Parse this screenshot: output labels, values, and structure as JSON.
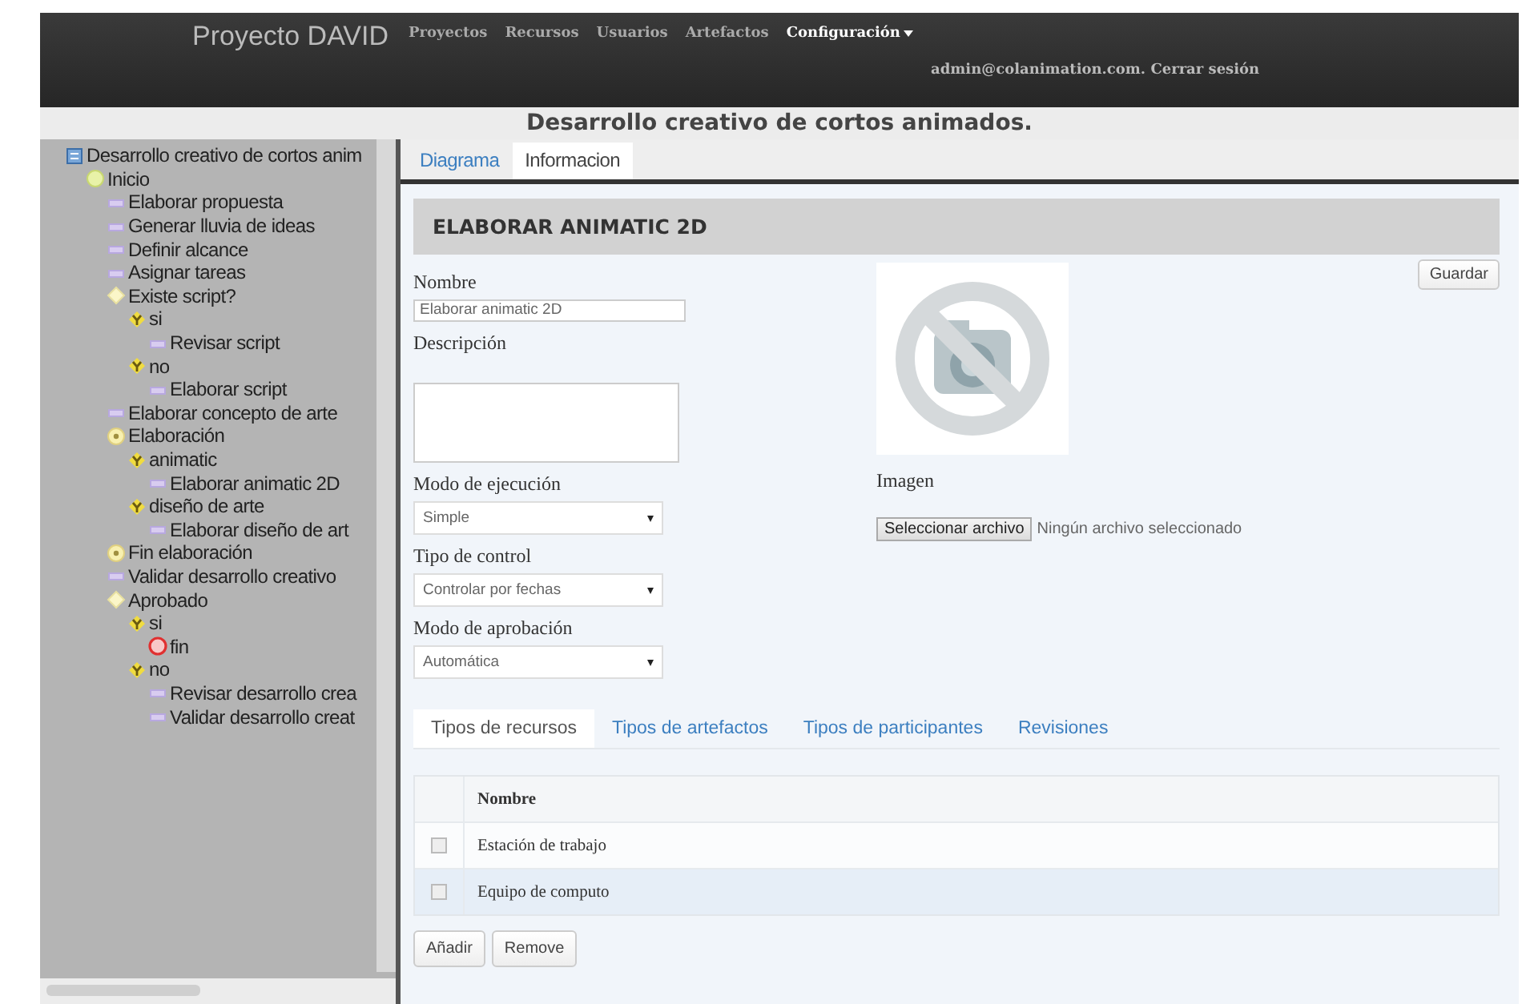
{
  "header": {
    "brand": "Proyecto DAVID",
    "nav": [
      {
        "label": "Proyectos",
        "selected": false,
        "dropdown": false
      },
      {
        "label": "Recursos",
        "selected": false,
        "dropdown": false
      },
      {
        "label": "Usuarios",
        "selected": false,
        "dropdown": false
      },
      {
        "label": "Artefactos",
        "selected": false,
        "dropdown": false
      },
      {
        "label": "Configuración",
        "selected": true,
        "dropdown": true
      }
    ],
    "user_line": "admin@colanimation.com. Cerrar sesión"
  },
  "page_title": "Desarrollo creativo de cortos animados.",
  "tree": [
    {
      "label": "Desarrollo creativo de cortos anim",
      "kind": "process",
      "children": [
        {
          "label": "Inicio",
          "kind": "start",
          "children": [
            {
              "label": "Elaborar propuesta",
              "kind": "task"
            },
            {
              "label": "Generar lluvia de ideas",
              "kind": "task"
            },
            {
              "label": "Definir alcance",
              "kind": "task"
            },
            {
              "label": "Asignar tareas",
              "kind": "task"
            },
            {
              "label": "Existe script?",
              "kind": "decision",
              "children": [
                {
                  "label": "si",
                  "kind": "branch",
                  "children": [
                    {
                      "label": "Revisar script",
                      "kind": "task"
                    }
                  ]
                },
                {
                  "label": "no",
                  "kind": "branch",
                  "children": [
                    {
                      "label": "Elaborar script",
                      "kind": "task"
                    }
                  ]
                }
              ]
            },
            {
              "label": "Elaborar concepto de arte",
              "kind": "task"
            },
            {
              "label": "Elaboración",
              "kind": "parallel",
              "children": [
                {
                  "label": "animatic",
                  "kind": "branch",
                  "children": [
                    {
                      "label": "Elaborar animatic 2D",
                      "kind": "task"
                    }
                  ]
                },
                {
                  "label": "diseño de arte",
                  "kind": "branch",
                  "children": [
                    {
                      "label": "Elaborar diseño de art",
                      "kind": "task"
                    }
                  ]
                }
              ]
            },
            {
              "label": "Fin elaboración",
              "kind": "parallel"
            },
            {
              "label": "Validar desarrollo creativo",
              "kind": "task"
            },
            {
              "label": "Aprobado",
              "kind": "decision",
              "children": [
                {
                  "label": "si",
                  "kind": "branch",
                  "children": [
                    {
                      "label": "fin",
                      "kind": "end"
                    }
                  ]
                },
                {
                  "label": "no",
                  "kind": "branch",
                  "children": [
                    {
                      "label": "Revisar desarrollo crea",
                      "kind": "task"
                    },
                    {
                      "label": "Validar desarrollo creat",
                      "kind": "task"
                    }
                  ]
                }
              ]
            }
          ]
        }
      ]
    }
  ],
  "tabs": [
    {
      "label": "Diagrama",
      "selected": false
    },
    {
      "label": "Informacion",
      "selected": true
    }
  ],
  "detail": {
    "heading": "ELABORAR ANIMATIC 2D",
    "save_button": "Guardar",
    "fields": [
      {
        "label": "Nombre",
        "kind": "text",
        "value": "Elaborar animatic 2D"
      },
      {
        "label": "Descripción",
        "kind": "textarea"
      },
      {
        "label": "Modo de ejecución",
        "kind": "select",
        "value": "Simple"
      },
      {
        "label": "Tipo de control",
        "kind": "select",
        "value": "Controlar por fechas"
      },
      {
        "label": "Modo de aprobación",
        "kind": "select",
        "value": "Automática"
      }
    ],
    "image": {
      "label": "Imagen",
      "file_button": "Seleccionar archivo",
      "file_status": "Ningún archivo seleccionado"
    },
    "subtabs": [
      {
        "label": "Tipos de recursos",
        "selected": true
      },
      {
        "label": "Tipos de artefactos",
        "selected": false
      },
      {
        "label": "Tipos de participantes",
        "selected": false
      },
      {
        "label": "Revisiones",
        "selected": false
      }
    ],
    "table": {
      "columns": [
        "Nombre"
      ],
      "rows": [
        {
          "cells": [
            "Estación de trabajo"
          ],
          "checked": false,
          "selected": false
        },
        {
          "cells": [
            "Equipo de computo"
          ],
          "checked": false,
          "selected": true
        }
      ]
    },
    "buttons": [
      "Añadir",
      "Remove"
    ]
  }
}
